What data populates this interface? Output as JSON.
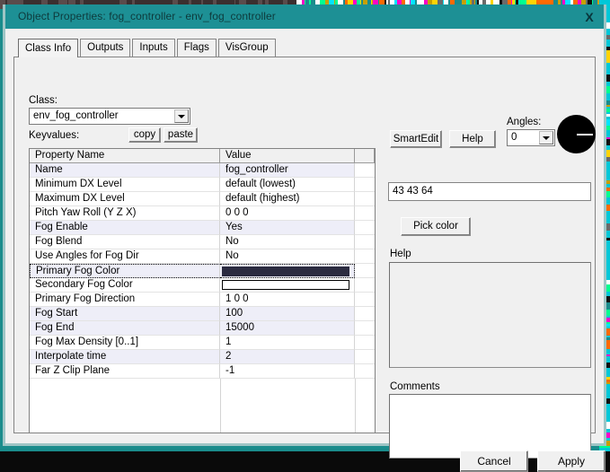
{
  "window": {
    "title": "Object Properties: fog_controller - env_fog_controller",
    "close_icon": "X"
  },
  "tabs": [
    {
      "label": "Class Info",
      "active": true
    },
    {
      "label": "Outputs",
      "active": false
    },
    {
      "label": "Inputs",
      "active": false
    },
    {
      "label": "Flags",
      "active": false
    },
    {
      "label": "VisGroup",
      "active": false
    }
  ],
  "left": {
    "class_label": "Class:",
    "class_value": "env_fog_controller",
    "keyvalues_label": "Keyvalues:",
    "copy_label": "copy",
    "paste_label": "paste"
  },
  "grid": {
    "headers": [
      "Property Name",
      "Value",
      ""
    ],
    "rows": [
      {
        "name": "Name",
        "value": "fog_controller",
        "shaded": true,
        "selected": false,
        "type": "text"
      },
      {
        "name": "Minimum DX Level",
        "value": "default (lowest)",
        "shaded": false,
        "selected": false,
        "type": "text"
      },
      {
        "name": "Maximum DX Level",
        "value": "default (highest)",
        "shaded": false,
        "selected": false,
        "type": "text"
      },
      {
        "name": "Pitch Yaw Roll (Y Z X)",
        "value": "0 0 0",
        "shaded": false,
        "selected": false,
        "type": "text"
      },
      {
        "name": "Fog Enable",
        "value": "Yes",
        "shaded": true,
        "selected": false,
        "type": "text"
      },
      {
        "name": "Fog Blend",
        "value": "No",
        "shaded": false,
        "selected": false,
        "type": "text"
      },
      {
        "name": "Use Angles for Fog Dir",
        "value": "No",
        "shaded": false,
        "selected": false,
        "type": "text"
      },
      {
        "name": "Primary Fog Color",
        "value": "",
        "shaded": true,
        "selected": true,
        "type": "color",
        "color": "#2b2b40"
      },
      {
        "name": "Secondary Fog Color",
        "value": "",
        "shaded": false,
        "selected": false,
        "type": "color",
        "color": "#ffffff"
      },
      {
        "name": "Primary Fog Direction",
        "value": "1 0 0",
        "shaded": false,
        "selected": false,
        "type": "text"
      },
      {
        "name": "Fog Start",
        "value": "100",
        "shaded": true,
        "selected": false,
        "type": "text"
      },
      {
        "name": "Fog End",
        "value": "15000",
        "shaded": true,
        "selected": false,
        "type": "text"
      },
      {
        "name": "Fog Max Density [0..1]",
        "value": "1",
        "shaded": false,
        "selected": false,
        "type": "text"
      },
      {
        "name": "Interpolate time",
        "value": "2",
        "shaded": true,
        "selected": false,
        "type": "text"
      },
      {
        "name": "Far Z Clip Plane",
        "value": "-1",
        "shaded": false,
        "selected": false,
        "type": "text"
      }
    ]
  },
  "right": {
    "smart_edit_label": "SmartEdit",
    "help_button_label": "Help",
    "angles_label": "Angles:",
    "angles_value": "0",
    "angle_dial_degrees": 0,
    "value_field": "43 43 64",
    "pick_color_label": "Pick color",
    "help_section_label": "Help",
    "help_text": "",
    "comments_label": "Comments",
    "comments_text": ""
  },
  "footer": {
    "cancel_label": "Cancel",
    "apply_label": "Apply"
  },
  "colors": {
    "titlebar": "#1d9095",
    "window_border": "#9ec5c5",
    "dialog_face": "#f0f0f0",
    "row_shaded": "#eeeef8",
    "primary_fog_color": "#2b2b40"
  }
}
